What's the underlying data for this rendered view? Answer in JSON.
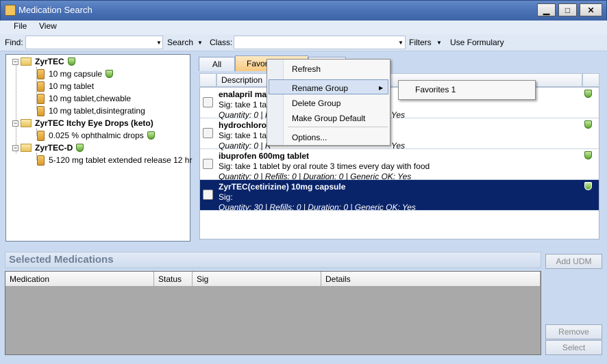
{
  "window": {
    "title": "Medication Search",
    "minimize": "▁",
    "maximize": "□",
    "close": "✕"
  },
  "menubar": {
    "items": [
      "File",
      "View"
    ]
  },
  "searchbar": {
    "find_label": "Find:",
    "search_label": "Search",
    "class_label": "Class:",
    "filters_label": "Filters",
    "use_formulary_label": "Use Formulary"
  },
  "tree": {
    "groups": [
      {
        "name": "ZyrTEC",
        "items": [
          "10 mg capsule",
          "10 mg tablet",
          "10 mg tablet,chewable",
          "10 mg tablet,disintegrating"
        ]
      },
      {
        "name": "ZyrTEC Itchy Eye Drops (keto)",
        "items": [
          "0.025 % ophthalmic drops"
        ]
      },
      {
        "name": "ZyrTEC-D",
        "items": [
          "5-120 mg tablet extended release 12 hr"
        ]
      }
    ]
  },
  "tabs": {
    "all": "All",
    "favorites": "Favori"
  },
  "list": {
    "column": "Description",
    "rows": [
      {
        "name": "enalapril mal",
        "sig": "Sig: take 1 tabl",
        "meta": "Quantity: 0 | R",
        "tail": "Yes"
      },
      {
        "name": "hydrochlorot",
        "sig": "Sig: take 1 tab",
        "meta": "Quantity: 0 | R",
        "tail": "Yes"
      },
      {
        "name": "ibuprofen 600mg tablet",
        "sig": "Sig: take 1 tablet by oral route 3 times every day with food",
        "meta": "Quantity: 0 | Refills: 0 | Duration: 0 | Generic OK: Yes",
        "tail": ""
      },
      {
        "name": "ZyrTEC(cetirizine) 10mg capsule",
        "sig": "Sig:",
        "meta": "Quantity: 30 | Refills: 0 | Duration: 0 | Generic OK: Yes",
        "tail": ""
      }
    ]
  },
  "context_menu": {
    "items": [
      "Refresh",
      "Rename Group",
      "Delete Group",
      "Make Group Default",
      "Options..."
    ],
    "submenu_arrow": "▶"
  },
  "submenu": {
    "items": [
      "Favorites 1"
    ]
  },
  "selected": {
    "title": "Selected Medications",
    "columns": [
      "Medication",
      "Status",
      "Sig",
      "Details"
    ]
  },
  "buttons": {
    "add_udm": "Add UDM",
    "remove": "Remove",
    "select": "Select"
  },
  "colors": {
    "selection": "#0a246a",
    "title_bar": "#4a72b5",
    "context_highlight": "#d6e2f3"
  }
}
